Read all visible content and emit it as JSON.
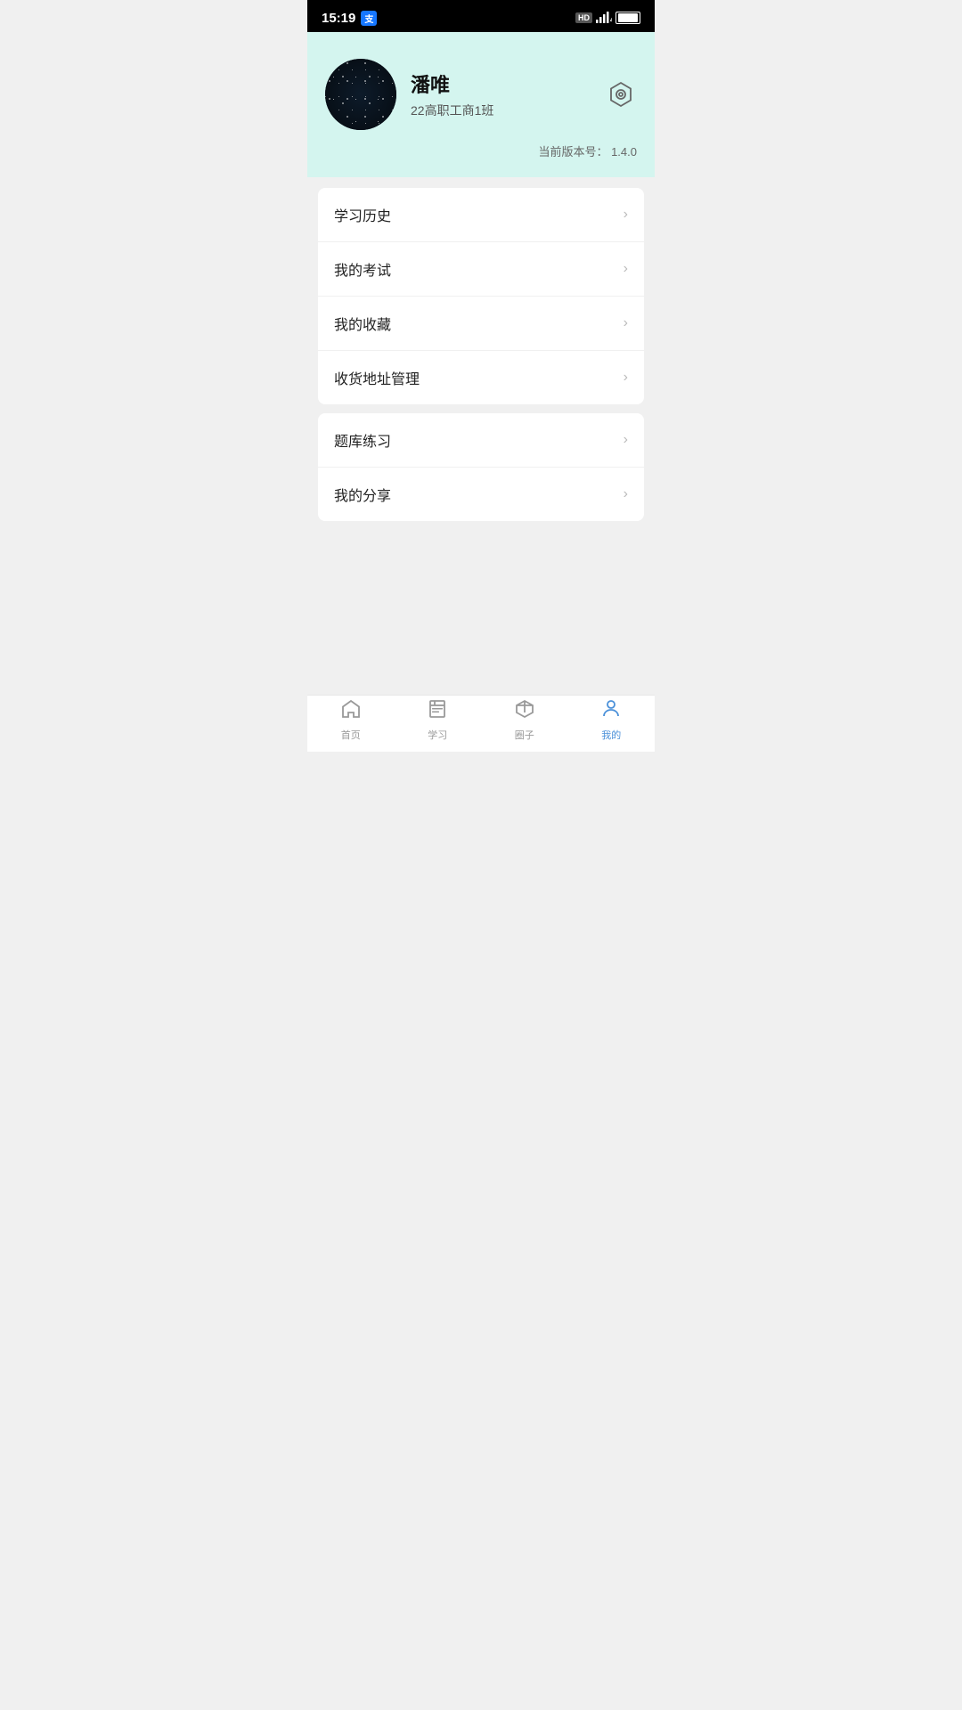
{
  "statusBar": {
    "time": "15:19",
    "alipayLabel": "支",
    "hdLabel": "HD",
    "signal": "4G",
    "battery": "100"
  },
  "profile": {
    "name": "潘唯",
    "class": "22高职工商1班",
    "versionLabel": "当前版本号：",
    "versionNumber": "1.4.0"
  },
  "menu": {
    "section1": [
      {
        "label": "学习历史"
      },
      {
        "label": "我的考试"
      },
      {
        "label": "我的收藏"
      },
      {
        "label": "收货地址管理"
      }
    ],
    "section2": [
      {
        "label": "题库练习"
      },
      {
        "label": "我的分享"
      }
    ]
  },
  "bottomNav": {
    "items": [
      {
        "label": "首页",
        "icon": "home",
        "active": false
      },
      {
        "label": "学习",
        "icon": "book",
        "active": false
      },
      {
        "label": "圈子",
        "icon": "box",
        "active": false
      },
      {
        "label": "我的",
        "icon": "person",
        "active": true
      }
    ]
  }
}
